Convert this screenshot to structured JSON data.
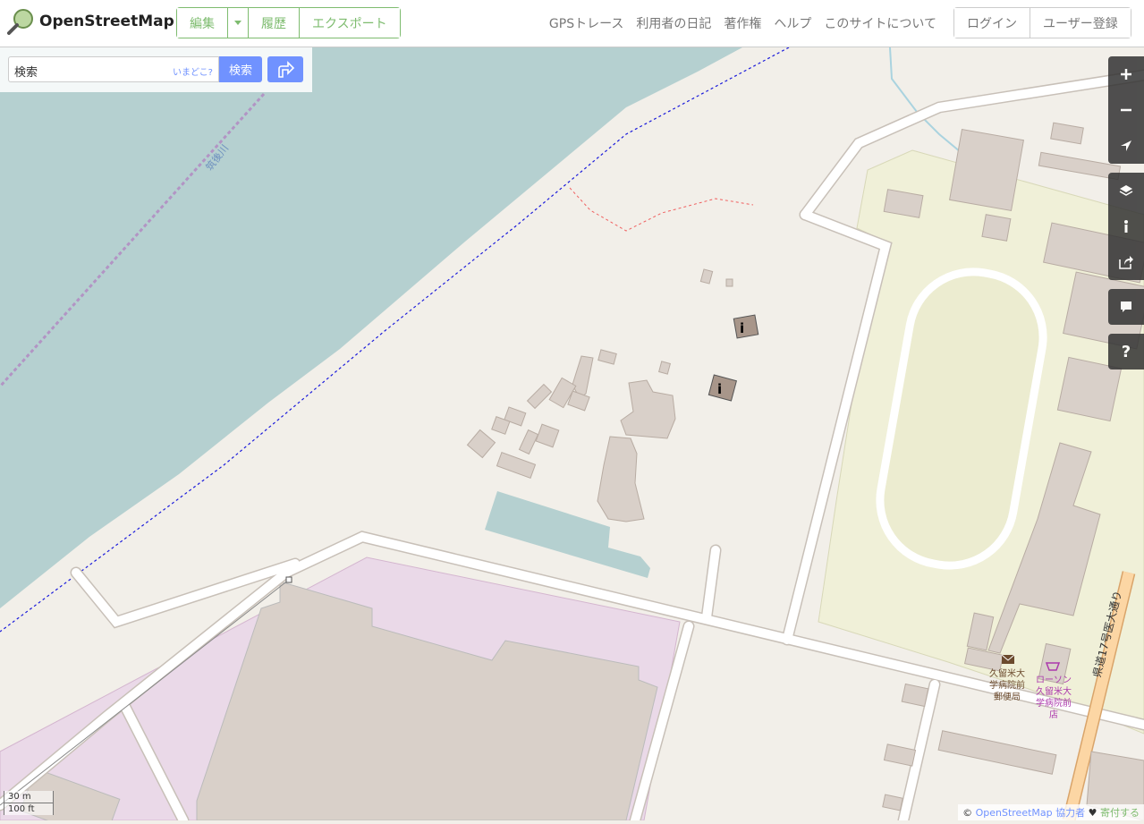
{
  "header": {
    "brand": "OpenStreetMap",
    "edit_label": "編集",
    "history_label": "履歴",
    "export_label": "エクスポート",
    "nav": [
      "GPSトレース",
      "利用者の日記",
      "著作権",
      "ヘルプ",
      "このサイトについて"
    ],
    "login_label": "ログイン",
    "signup_label": "ユーザー登録"
  },
  "search": {
    "placeholder": "検索",
    "where_label": "いまどこ?",
    "go_label": "検索"
  },
  "map": {
    "river_label": "筑後川",
    "road_label": "県道17号医大通り",
    "post_office_label": [
      "久留米大",
      "学病院前",
      "郵便局"
    ],
    "lawson_label": [
      "ローソン",
      "久留米大",
      "学病院前",
      "店"
    ],
    "colors": {
      "land": "#f2efe9",
      "water": "#b5d0d0",
      "building": "#d9d0c9",
      "hospital": "#ead9e8",
      "school": "#f0f0d8",
      "road_major": "#fcd6a4"
    }
  },
  "controls": [
    "zoom-in-icon",
    "zoom-out-icon",
    "locate-icon",
    "layers-icon",
    "info-icon",
    "share-icon",
    "note-icon",
    "help-icon"
  ],
  "scale": {
    "metric": "30 m",
    "imperial": "100 ft"
  },
  "attribution": {
    "copy": "© ",
    "osm_link": "OpenStreetMap",
    "contributors": "協力者",
    "heart": "♥",
    "donate": "寄付する"
  }
}
